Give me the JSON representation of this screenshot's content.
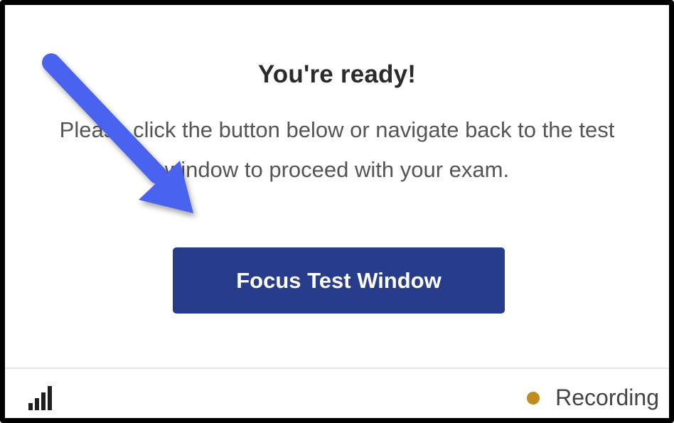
{
  "dialog": {
    "title": "You're ready!",
    "message": "Please click the button below or navigate back to the test window to proceed with your exam.",
    "button_label": "Focus Test Window"
  },
  "footer": {
    "signal_icon": "signal-strength-icon",
    "recording_label": "Recording",
    "recording_color": "#c08a1e"
  },
  "annotation": {
    "icon": "arrow-pointer-icon",
    "color": "#4a62f0"
  },
  "colors": {
    "button_bg": "#273d8b",
    "button_text": "#ffffff",
    "frame_border": "#000000"
  }
}
